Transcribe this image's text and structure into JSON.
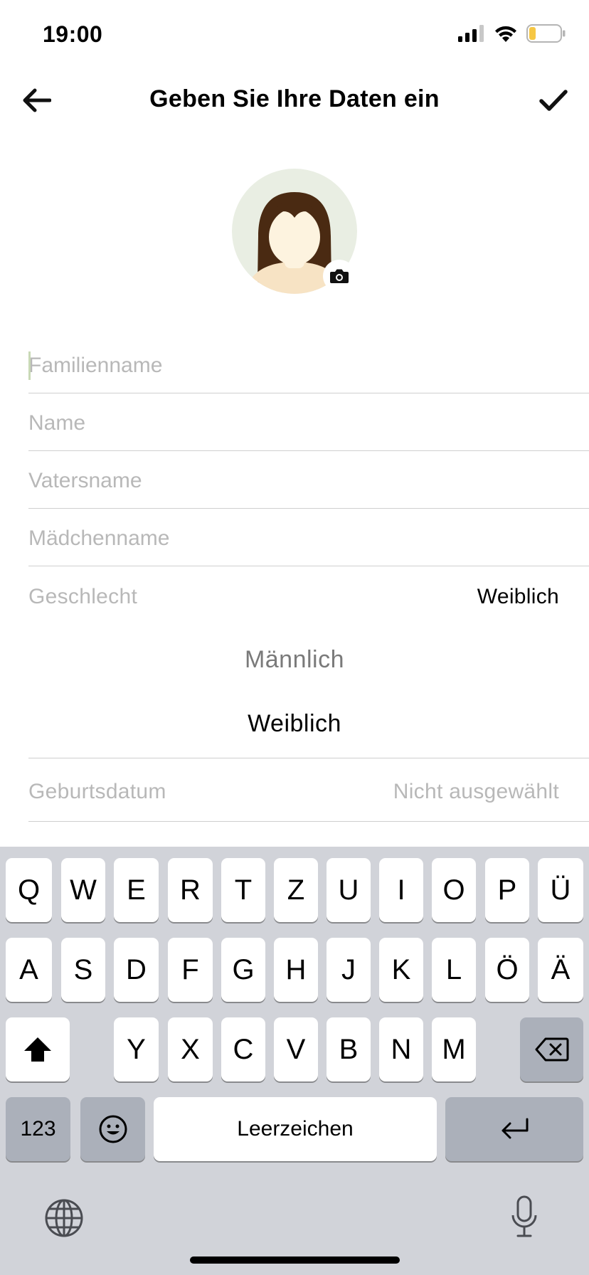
{
  "status_bar": {
    "time": "19:00",
    "icons": [
      "cellular-signal-icon",
      "wifi-icon",
      "battery-icon"
    ]
  },
  "nav": {
    "title": "Geben Sie Ihre Daten ein",
    "back_icon": "arrow-left-icon",
    "done_icon": "checkmark-icon"
  },
  "avatar": {
    "icon": "female-avatar-icon",
    "badge_icon": "camera-icon",
    "colors": {
      "background": "#e9eee3",
      "hair": "#4a2a12",
      "skin": "#fdf3df"
    }
  },
  "form": {
    "family_name": {
      "placeholder": "Familienname",
      "value": ""
    },
    "name": {
      "placeholder": "Name",
      "value": ""
    },
    "patronymic": {
      "placeholder": "Vatersname",
      "value": ""
    },
    "maiden_name": {
      "placeholder": "Mädchenname",
      "value": ""
    },
    "gender": {
      "label": "Geschlecht",
      "value": "Weiblich",
      "options": [
        "Männlich",
        "Weiblich"
      ],
      "selected_index": 1
    },
    "birth_date": {
      "label": "Geburtsdatum",
      "value": "Nicht ausgewählt"
    }
  },
  "keyboard": {
    "row1": [
      "Q",
      "W",
      "E",
      "R",
      "T",
      "Z",
      "U",
      "I",
      "O",
      "P",
      "Ü"
    ],
    "row2": [
      "A",
      "S",
      "D",
      "F",
      "G",
      "H",
      "J",
      "K",
      "L",
      "Ö",
      "Ä"
    ],
    "row3": [
      "Y",
      "X",
      "C",
      "V",
      "B",
      "N",
      "M"
    ],
    "numbers_label": "123",
    "space_label": "Leerzeichen",
    "icons": {
      "shift": "shift-icon",
      "delete": "backspace-icon",
      "emoji": "emoji-icon",
      "return": "return-icon",
      "globe": "globe-icon",
      "mic": "microphone-icon"
    },
    "colors": {
      "background": "#d1d3d9",
      "key": "#ffffff",
      "function_key": "#abb0ba"
    }
  }
}
